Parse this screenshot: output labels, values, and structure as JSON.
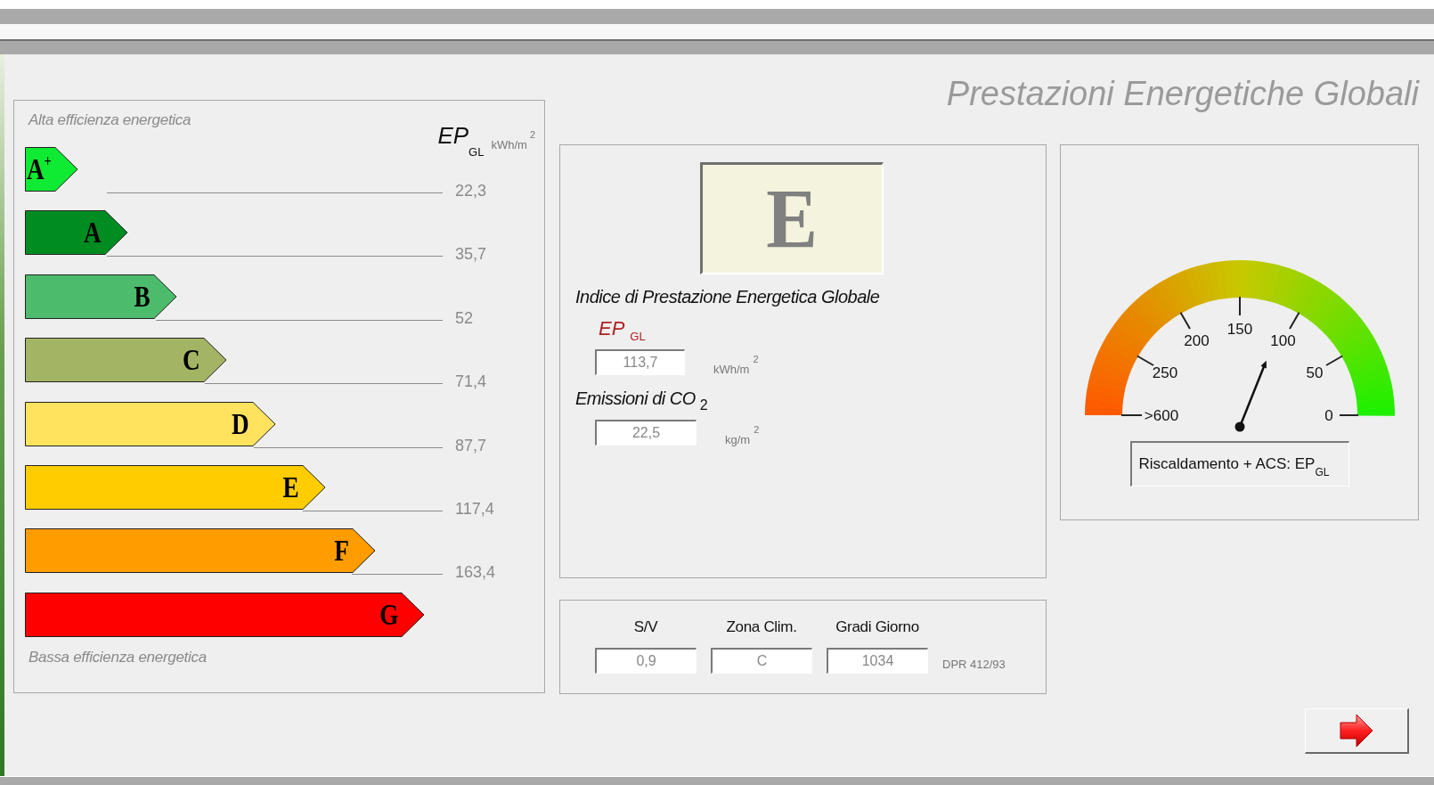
{
  "title": "Prestazioni Energetiche Globali",
  "scale": {
    "top_label": "Alta efficienza energetica",
    "unit_heading": "EP$_{GL}$",
    "unit": "kWh/m$^{2}$",
    "classes": [
      {
        "letter": "A$^{+}$",
        "color": "#0fea32"
      },
      {
        "letter": "A",
        "color": "#008c20"
      },
      {
        "letter": "B",
        "color": "#4cbb6c"
      },
      {
        "letter": "C",
        "color": "#a3b565"
      },
      {
        "letter": "D",
        "color": "#ffe35e"
      },
      {
        "letter": "E",
        "color": "#ffcc00"
      },
      {
        "letter": "F",
        "color": "#ff9c00"
      },
      {
        "letter": "G",
        "color": "#ff0000"
      }
    ],
    "thresholds": [
      "22,3",
      "35,7",
      "52",
      "71,4",
      "87,7",
      "117,4",
      "163,4"
    ],
    "bottom_label": "Bassa efficienza energetica"
  },
  "result": {
    "energy_class": "E",
    "index_heading": "Indice di Prestazione Energetica Globale",
    "ep_label": "EP$_{GL}$",
    "ep_value": "113,7",
    "ep_unit": "kWh/m$^{2}$",
    "co2_heading": "Emissioni di CO$_{2}$",
    "co2_value": "22,5",
    "co2_unit": "kg/m$^{2}$"
  },
  "gauge": {
    "tick_labels": [
      ">600",
      "250",
      "200",
      "150",
      "100",
      "50",
      "0"
    ],
    "caption": "Riscaldamento + ACS: EP$_{GL}$"
  },
  "climate": {
    "fields": [
      {
        "label": "S/V",
        "value": "0,9"
      },
      {
        "label": "Zona Clim.",
        "value": "C"
      },
      {
        "label": "Gradi Giorno",
        "value": "1034"
      }
    ],
    "note": "DPR 412/93"
  }
}
